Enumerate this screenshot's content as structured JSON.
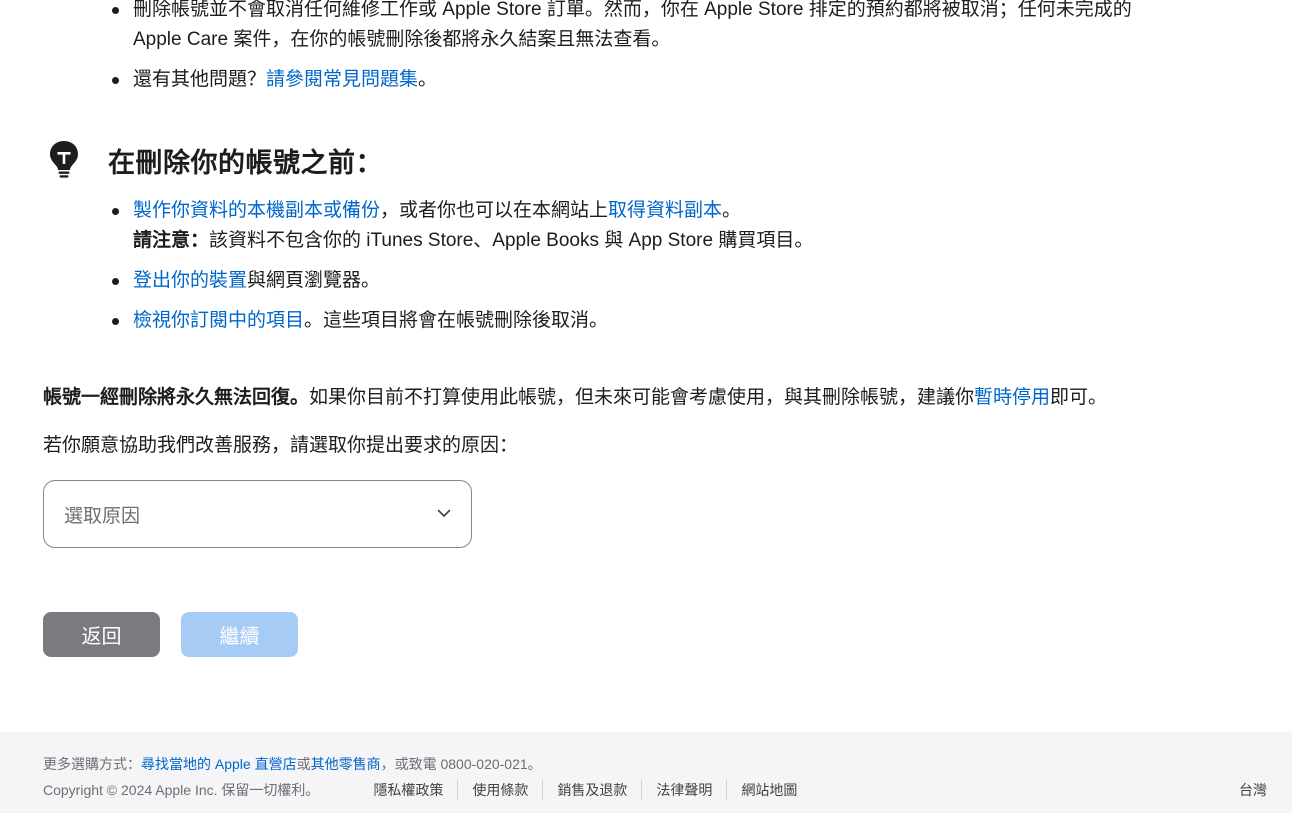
{
  "top_list": {
    "item1": {
      "line1": "刪除帳號並不會取消任何維修工作或 Apple Store 訂單。然而，你在 Apple Store 排定的預約都將被取消；任何未完成的",
      "line2": "Apple Care 案件，在你的帳號刪除後都將永久結案且無法查看。"
    },
    "item2": {
      "text": "還有其他問題？",
      "link": "請參閱常見問題集",
      "suffix": "。"
    }
  },
  "section": {
    "icon": "lightbulb-icon",
    "title": "在刪除你的帳號之前："
  },
  "before_list": {
    "item1": {
      "link1": "製作你資料的本機副本或備份",
      "mid": "，或者你也可以在本網站上",
      "link2": "取得資料副本",
      "suffix": "。",
      "note_label": "請注意：",
      "note_text": "該資料不包含你的 iTunes Store、Apple Books 與 App Store 購買項目。"
    },
    "item2": {
      "link": "登出你的裝置",
      "suffix": "與網頁瀏覽器。"
    },
    "item3": {
      "link": "檢視你訂閱中的項目",
      "suffix": "。這些項目將會在帳號刪除後取消。"
    }
  },
  "warning": {
    "bold": "帳號一經刪除將永久無法回復。",
    "text": "如果你目前不打算使用此帳號，但未來可能會考慮使用，與其刪除帳號，建議你",
    "link": "暫時停用",
    "suffix": "即可。"
  },
  "reason_prompt": "若你願意協助我們改善服務，請選取你提出要求的原因：",
  "reason_select": {
    "placeholder": "選取原因",
    "icon": "chevron-down-icon"
  },
  "buttons": {
    "back": "返回",
    "continue": "繼續"
  },
  "colors": {
    "link": "#0066cc",
    "back_button": "#7a7a7f",
    "continue_button_disabled": "#a6cbf4",
    "footer_bg": "#f5f5f7"
  },
  "footer": {
    "shop_prefix": "更多選購方式：",
    "shop_link1": "尋找當地的 Apple 直營店",
    "shop_or": "或",
    "shop_link2": "其他零售商",
    "shop_suffix": "，或致電 0800-020-021。",
    "copyright": "Copyright © 2024 Apple Inc. 保留一切權利。",
    "links": [
      "隱私權政策",
      "使用條款",
      "銷售及退款",
      "法律聲明",
      "網站地圖"
    ],
    "region": "台灣"
  }
}
